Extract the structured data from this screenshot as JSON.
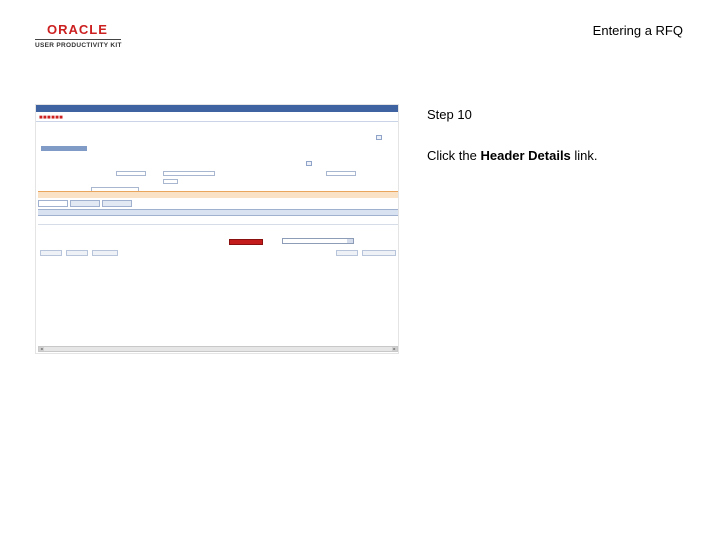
{
  "slide": {
    "logo_word": "ORACLE",
    "logo_subtitle": "USER PRODUCTIVITY KIT",
    "title": "Entering a RFQ",
    "step": "Step 10",
    "instruction_prefix": "Click the ",
    "instruction_link": "Header Details",
    "instruction_suffix": " link."
  },
  "colors": {
    "oracle_red": "#cc1f1f",
    "menu_blue": "#3f62a0",
    "link_blue": "#2d4d8c",
    "orange_header": "#d45a10"
  }
}
